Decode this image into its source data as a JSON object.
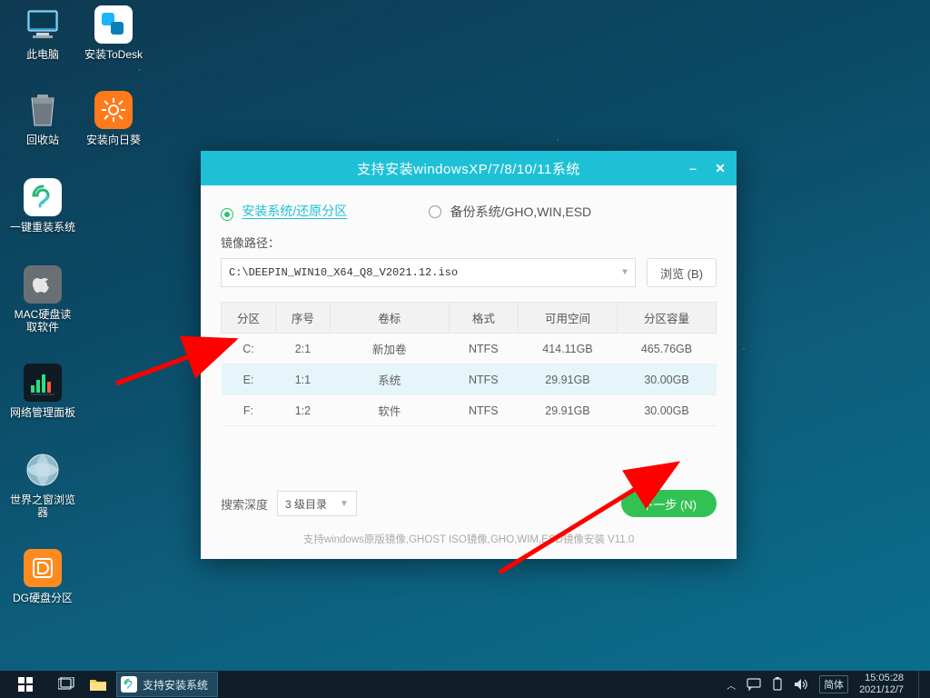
{
  "desktop_icons": [
    {
      "label": "此电脑"
    },
    {
      "label": "安装ToDesk"
    },
    {
      "label": "回收站"
    },
    {
      "label": "安装向日葵"
    },
    {
      "label": "一键重装系统"
    },
    {
      "label": "MAC硬盘读取软件"
    },
    {
      "label": "网络管理面板"
    },
    {
      "label": "世界之窗浏览器"
    },
    {
      "label": "DG硬盘分区"
    }
  ],
  "window": {
    "title": "支持安装windowsXP/7/8/10/11系统",
    "tab_install": "安装系统/还原分区",
    "tab_backup": "备份系统/GHO,WIN,ESD",
    "image_path_label": "镜像路径：",
    "image_path": "C:\\DEEPIN_WIN10_X64_Q8_V2021.12.iso",
    "browse": "浏览 (B)",
    "headers": {
      "part": "分区",
      "ord": "序号",
      "vol": "卷标",
      "fmt": "格式",
      "free": "可用空间",
      "size": "分区容量"
    },
    "rows": [
      {
        "part": "C:",
        "ord": "2:1",
        "vol": "新加卷",
        "fmt": "NTFS",
        "free": "414.11GB",
        "size": "465.76GB"
      },
      {
        "part": "E:",
        "ord": "1:1",
        "vol": "系统",
        "fmt": "NTFS",
        "free": "29.91GB",
        "size": "30.00GB"
      },
      {
        "part": "F:",
        "ord": "1:2",
        "vol": "软件",
        "fmt": "NTFS",
        "free": "29.91GB",
        "size": "30.00GB"
      }
    ],
    "search_depth_label": "搜索深度",
    "search_depth_value": "3 级目录",
    "next": "下一步 (N)",
    "support_text": "支持windows原版镜像,GHOST ISO镜像,GHO,WIM,ESD镜像安装 V11.0"
  },
  "taskbar": {
    "app_label": "支持安装系统",
    "ime": "简体",
    "time": "15:05:28",
    "date": "2021/12/7"
  }
}
